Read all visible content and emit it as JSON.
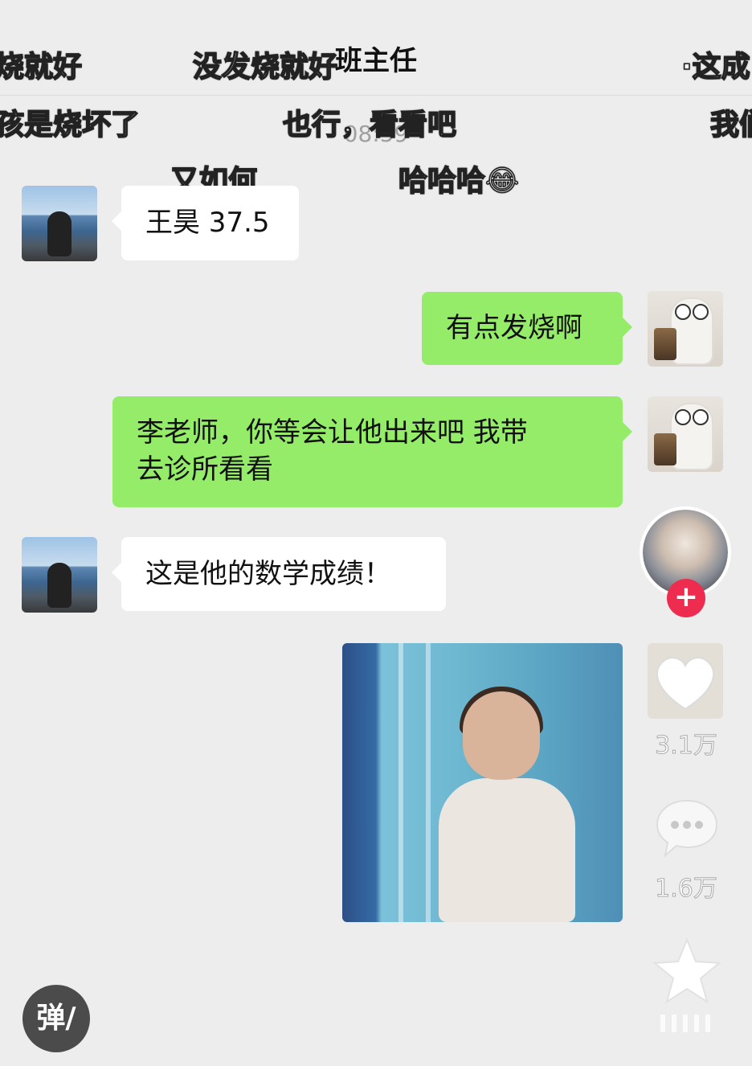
{
  "header": {
    "title": "班主任"
  },
  "time": "08:59",
  "danmaku": [
    "烧就好",
    "没发烧就好",
    "·这成",
    "孩是烧坏了",
    "也行，看看吧",
    "我们",
    "又如何",
    "哈哈哈😂"
  ],
  "messages": [
    {
      "side": "left",
      "text": "王昊 37.5"
    },
    {
      "side": "right",
      "text": "有点发烧啊"
    },
    {
      "side": "right",
      "line1": "李老师，你等会让他出来吧 我带",
      "line2": "去诊所看看"
    },
    {
      "side": "left",
      "text": "这是他的数学成绩！"
    }
  ],
  "rail": {
    "like_count": "3.1万",
    "comment_count": "1.6万",
    "follow_symbol": "+"
  },
  "danmu_button": {
    "label": "弹/"
  }
}
